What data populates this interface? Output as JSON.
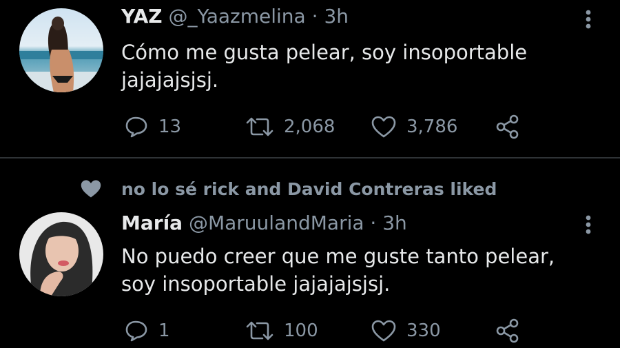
{
  "colors": {
    "background": "#000000",
    "text_primary": "#e7e9ea",
    "text_secondary": "#8b98a5",
    "divider": "#2f3336"
  },
  "icons": {
    "reply": "reply-icon",
    "retweet": "retweet-icon",
    "like": "heart-icon",
    "share": "share-icon",
    "more": "more-vertical-icon",
    "liked_context": "heart-filled-icon"
  },
  "tweets": [
    {
      "display_name": "YAZ",
      "handle": "@_Yaazmelina",
      "separator": "·",
      "time": "3h",
      "text_line1": "Cómo me gusta pelear, soy insoportable",
      "text_line2": "jajajajsjsj.",
      "replies": "13",
      "retweets": "2,068",
      "likes": "3,786"
    },
    {
      "social_context": "no lo sé rick and David Contreras liked",
      "display_name": "María",
      "handle": "@MaruulandMaria",
      "separator": "·",
      "time": "3h",
      "text_line1": "No puedo creer que me guste tanto pelear,",
      "text_line2": "soy insoportable jajajajsjsj.",
      "replies": "1",
      "retweets": "100",
      "likes": "330"
    }
  ]
}
